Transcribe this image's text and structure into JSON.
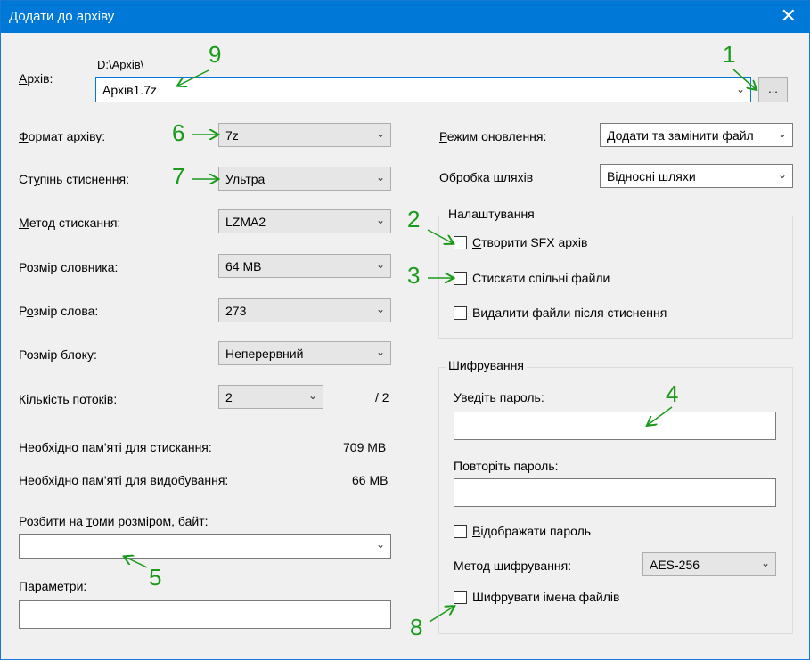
{
  "window": {
    "title": "Додати до архіву",
    "close_glyph": "✕"
  },
  "archive": {
    "label": "Архів:",
    "path": "D:\\Архів\\",
    "filename": "Архів1.7z",
    "browse_label": "..."
  },
  "left": {
    "format": {
      "label": "Формат архіву:",
      "value": "7z"
    },
    "level": {
      "label": "Ступінь стиснення:",
      "value": "Ультра"
    },
    "method": {
      "label": "Метод стискання:",
      "value": "LZMA2"
    },
    "dict": {
      "label": "Розмір словника:",
      "value": "64 MB"
    },
    "word": {
      "label": "Розмір слова:",
      "value": "273"
    },
    "block": {
      "label": "Розмір блоку:",
      "value": "Неперервний"
    },
    "threads": {
      "label": "Кількість потоків:",
      "value": "2",
      "max": "/ 2"
    },
    "mem_compress": {
      "label": "Необхідно пам'яті для стискання:",
      "value": "709 MB"
    },
    "mem_decompress": {
      "label": "Необхідно пам'яті для видобування:",
      "value": "66 MB"
    },
    "split": {
      "label": "Розбити на томи розміром, байт:",
      "value": ""
    },
    "params": {
      "label": "Параметри:",
      "value": ""
    }
  },
  "right": {
    "update": {
      "label": "Режим оновлення:",
      "value": "Додати та замінити файл"
    },
    "paths": {
      "label": "Обробка шляхів",
      "value": "Відносні шляхи"
    },
    "options": {
      "title": "Налаштування",
      "sfx": "Створити SFX архів",
      "shared": "Стискати спільні файли",
      "delete": "Видалити файли після стиснення"
    },
    "encryption": {
      "title": "Шифрування",
      "enter": "Уведіть пароль:",
      "repeat": "Повторіть пароль:",
      "show": "Відображати пароль",
      "method_label": "Метод шифрування:",
      "method_value": "AES-256",
      "encrypt_names": "Шифрувати імена файлів"
    }
  },
  "annotations": {
    "n1": "1",
    "n2": "2",
    "n3": "3",
    "n4": "4",
    "n5": "5",
    "n6": "6",
    "n7": "7",
    "n8": "8",
    "n9": "9",
    "color": "#1a9a1a"
  }
}
